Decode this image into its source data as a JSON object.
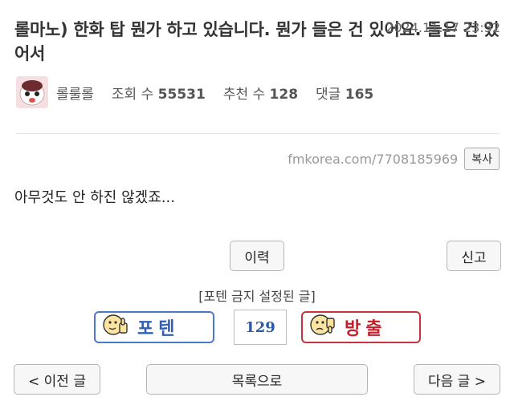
{
  "post": {
    "title": "롤마노) 한화 탑 뭔가 하고 있습니다. 뭔가 들은 건 있어요. 들은 건 있어서",
    "date": "2024.11.17 23:32",
    "author": "롤룰롤",
    "views_label": "조회 수",
    "views": "55531",
    "recommend_label": "추천 수",
    "recommend": "128",
    "comments_label": "댓글",
    "comments": "165",
    "url": "fmkorea.com/7708185969",
    "copy_label": "복사",
    "content": "아무것도 안 하진 않겠죠..."
  },
  "actions": {
    "history_label": "이력",
    "report_label": "신고",
    "notice": "[포텐 금지 설정된 글]",
    "upvote_label": "포텐",
    "vote_count": "129",
    "downvote_label": "방출"
  },
  "nav": {
    "prev_label": "< 이전 글",
    "list_label": "목록으로",
    "next_label": "다음 글 >"
  },
  "colors": {
    "upvote": "#2f5fb8",
    "downvote": "#c41e2b",
    "count": "#2c5aa0"
  }
}
